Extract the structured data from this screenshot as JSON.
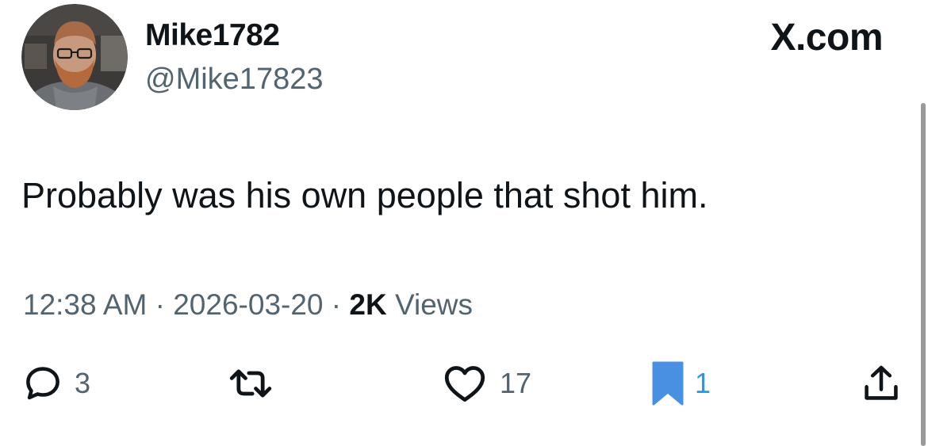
{
  "author": {
    "display_name": "Mike1782",
    "handle": "@Mike17823"
  },
  "brand": {
    "domain": "X.com"
  },
  "tweet": {
    "text": "Probably was his own people that shot him."
  },
  "meta": {
    "time": "12:38 AM",
    "separator": "·",
    "date": "2026-03-20",
    "views_count": "2K",
    "views_label": "Views"
  },
  "actions": {
    "reply": {
      "icon": "reply-icon",
      "count": "3"
    },
    "retweet": {
      "icon": "retweet-icon"
    },
    "like": {
      "icon": "heart-icon",
      "count": "17"
    },
    "bookmark": {
      "icon": "bookmark-icon",
      "count": "1",
      "active": true
    },
    "share": {
      "icon": "share-icon"
    }
  },
  "colors": {
    "text_primary": "#0f1419",
    "text_secondary": "#536471",
    "accent": "#1d9bf0",
    "bookmark_fill": "#4a90e2"
  }
}
